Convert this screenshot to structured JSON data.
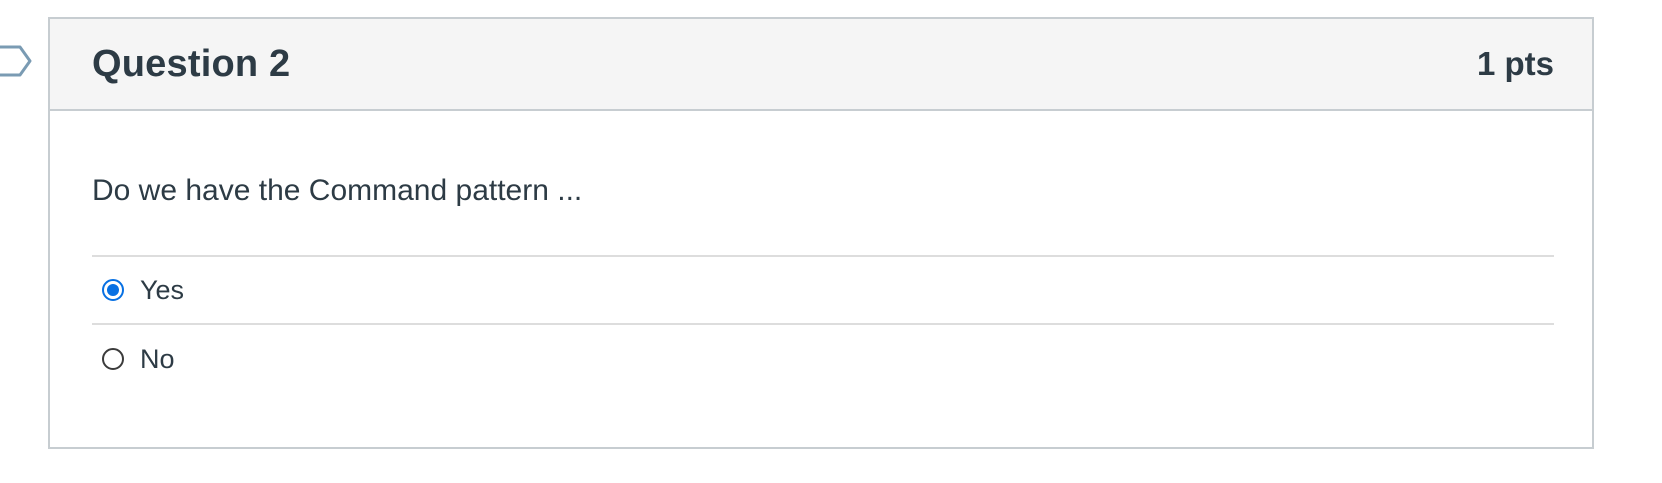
{
  "question": {
    "title": "Question 2",
    "points": "1 pts",
    "text": "Do we have the Command pattern ...",
    "answers": [
      {
        "label": "Yes",
        "selected": true
      },
      {
        "label": "No",
        "selected": false
      }
    ]
  },
  "colors": {
    "header_bg": "#f5f5f5",
    "border": "#c7cdd1",
    "text": "#2d3b45",
    "radio_selected": "#0770e3",
    "flag_outline": "#7a9bb3"
  },
  "icons": {
    "flag": "flag-question-icon"
  }
}
